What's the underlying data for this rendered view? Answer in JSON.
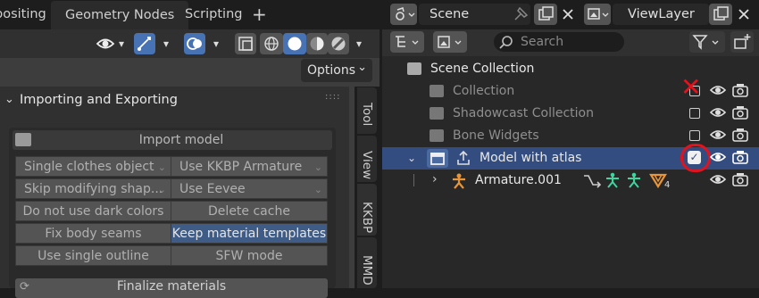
{
  "top_bar": {
    "workspaces": [
      "positing",
      "Geometry Nodes",
      "Scripting"
    ],
    "add_label": "+",
    "scene_label": "Scene",
    "viewlayer_label": "ViewLayer"
  },
  "viewport": {
    "options_label": "Options",
    "options_chevron": "⌄"
  },
  "panel": {
    "title": "Importing and Exporting",
    "chevron": "⌄",
    "grip": "::::",
    "import_title": "Import model",
    "rows": [
      [
        {
          "label": "Single clothes object",
          "dropdown": true
        },
        {
          "label": "Use KKBP Armature",
          "dropdown": true
        }
      ],
      [
        {
          "label": "Skip modifying shap...",
          "dropdown": true
        },
        {
          "label": "Use Eevee",
          "dropdown": true
        }
      ],
      [
        {
          "label": "Do not use dark colors"
        },
        {
          "label": "Delete cache"
        }
      ],
      [
        {
          "label": "Fix body seams"
        },
        {
          "label": "Keep material templates",
          "selected": true
        }
      ],
      [
        {
          "label": "Use single outline"
        },
        {
          "label": "SFW mode"
        }
      ]
    ],
    "finalize_label": "Finalize materials",
    "dropdown_glyph": "⌄"
  },
  "side_tabs": [
    "Tool",
    "View",
    "KKBP",
    "MMD"
  ],
  "outliner": {
    "search_placeholder": "Search",
    "scene_collection_label": "Scene Collection",
    "rows": [
      {
        "label": "Collection"
      },
      {
        "label": "Shadowcast Collection"
      },
      {
        "label": "Bone Widgets"
      },
      {
        "label": "Model with atlas",
        "selected": true,
        "checked": true
      },
      {
        "label": "Armature.001"
      }
    ],
    "mesh_count": "4",
    "annotation_x": "✕",
    "checkmark": "✓"
  },
  "colors": {
    "accent_blue": "#4772b3",
    "selected_row": "#334d80",
    "annotation_red": "#e0141e",
    "armature_orange": "#e8953a",
    "bone_green": "#3ed6a0"
  }
}
